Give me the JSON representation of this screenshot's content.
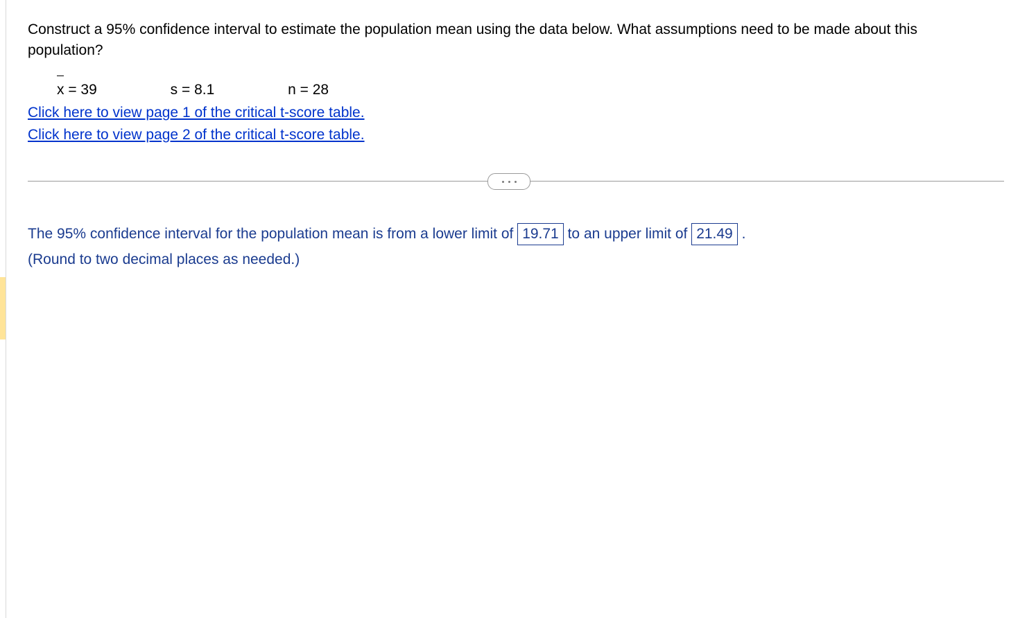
{
  "question": {
    "prompt": "Construct a 95% confidence interval to estimate the population mean using the data below. What assumptions need to be made about this population?",
    "stats": {
      "xbar_label": "x",
      "xbar_eq": " = 39",
      "s": "s = 8.1",
      "n": "n = 28"
    },
    "links": {
      "page1": "Click here to view page 1 of the critical t-score table.",
      "page2": "Click here to view page 2 of the critical t-score table."
    }
  },
  "answer": {
    "pre_lower": "The 95% confidence interval for the population mean is from a lower limit of ",
    "lower_value": "19.71",
    "between": " to an upper limit of ",
    "upper_value": "21.49",
    "post_upper": " .",
    "rounding_note": "(Round to two decimal places as needed.)"
  }
}
